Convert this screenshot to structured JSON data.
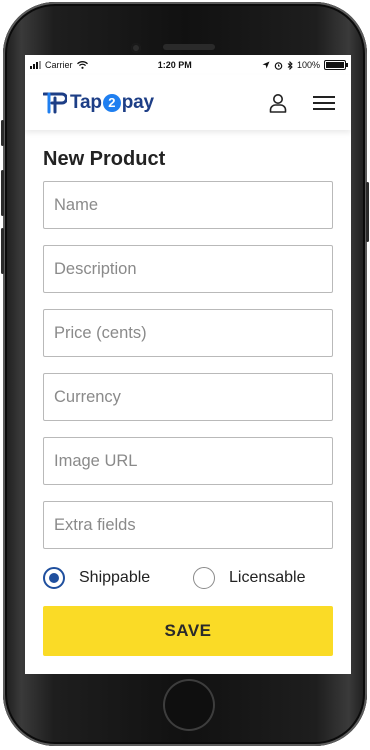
{
  "status_bar": {
    "carrier": "Carrier",
    "time": "1:20 PM",
    "battery": "100%",
    "icons": [
      "signal-icon",
      "wifi-icon",
      "location-icon",
      "alarm-icon",
      "bluetooth-icon",
      "battery-icon"
    ]
  },
  "header": {
    "logo_prefix": "Tap",
    "logo_digit": "2",
    "logo_suffix": "pay",
    "brand_color": "#1d3e86",
    "accent_color": "#1f7ff0",
    "icons": [
      "user-icon",
      "menu-icon"
    ]
  },
  "form": {
    "title": "New Product",
    "fields": [
      {
        "placeholder": "Name",
        "value": ""
      },
      {
        "placeholder": "Description",
        "value": ""
      },
      {
        "placeholder": "Price (cents)",
        "value": ""
      },
      {
        "placeholder": "Currency",
        "value": ""
      },
      {
        "placeholder": "Image URL",
        "value": ""
      },
      {
        "placeholder": "Extra fields",
        "value": ""
      }
    ],
    "radios": [
      {
        "label": "Shippable",
        "checked": true
      },
      {
        "label": "Licensable",
        "checked": false
      }
    ],
    "save_label": "SAVE",
    "save_color": "#fadb26"
  }
}
